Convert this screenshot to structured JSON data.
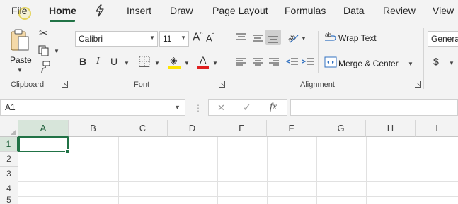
{
  "tabs": [
    {
      "label": "File",
      "active": false
    },
    {
      "label": "Home",
      "active": true
    },
    {
      "label": "Draw-tool",
      "active": false
    },
    {
      "label": "Insert",
      "active": false
    },
    {
      "label": "Draw",
      "active": false
    },
    {
      "label": "Page Layout",
      "active": false
    },
    {
      "label": "Formulas",
      "active": false
    },
    {
      "label": "Data",
      "active": false
    },
    {
      "label": "Review",
      "active": false
    },
    {
      "label": "View",
      "active": false
    }
  ],
  "tab_labels": {
    "file": "File",
    "home": "Home",
    "insert": "Insert",
    "draw": "Draw",
    "page_layout": "Page Layout",
    "formulas": "Formulas",
    "data": "Data",
    "review": "Review",
    "view": "View"
  },
  "ribbon": {
    "clipboard": {
      "label": "Clipboard",
      "paste_label": "Paste"
    },
    "font": {
      "label": "Font",
      "font_name": "Calibri",
      "font_size": "11",
      "bold": "B",
      "italic": "I",
      "underline": "U",
      "grow": "A",
      "shrink": "A",
      "font_color_glyph": "A"
    },
    "alignment": {
      "label": "Alignment",
      "wrap_text": "Wrap Text",
      "merge_center": "Merge & Center"
    },
    "number": {
      "format": "Genera",
      "currency": "$"
    }
  },
  "accent_colors": {
    "excel_green": "#217346",
    "highlight_yellow": "#ffe500",
    "font_red": "#e02020"
  },
  "formula_bar": {
    "name_box": "A1",
    "cancel_glyph": "✕",
    "enter_glyph": "✓",
    "fx_glyph": "fx",
    "formula": ""
  },
  "grid": {
    "columns": [
      "A",
      "B",
      "C",
      "D",
      "E",
      "F",
      "G",
      "H",
      "I"
    ],
    "rows": [
      "1",
      "2",
      "3",
      "4",
      "5"
    ],
    "active_cell": "A1"
  }
}
